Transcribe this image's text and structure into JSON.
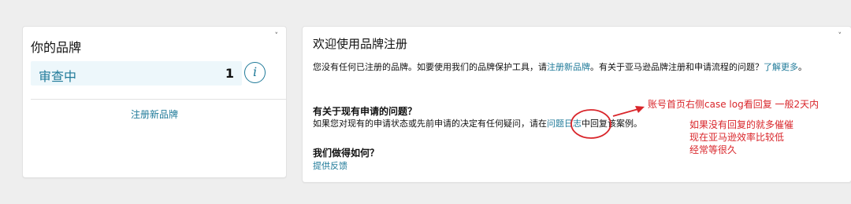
{
  "left_card": {
    "title": "你的品牌",
    "collapse_glyph": "˅",
    "review": {
      "label": "审查中",
      "count": "1",
      "info_glyph": "i"
    },
    "register_link": "注册新品牌"
  },
  "right_card": {
    "title": "欢迎使用品牌注册",
    "collapse_glyph": "˅",
    "intro": {
      "part1": "您没有任何已注册的品牌。如要使用我们的品牌保护工具，请",
      "link1": "注册新品牌",
      "part2": "。有关于亚马逊品牌注册和申请流程的问题？",
      "link2": "了解更多",
      "part3": "。"
    },
    "section1": {
      "heading": "有关于现有申请的问题？",
      "text_before": "如果您对现有的申请状态或先前申请的决定有任何疑问，请在",
      "link": "问题日志",
      "text_after": "中回复该案例。"
    },
    "section2": {
      "heading": "我们做得如何？",
      "link": "提供反馈"
    }
  },
  "annotations": {
    "arrow_note": "账号首页右侧case log看回复 一般2天内",
    "side_note_lines": [
      "如果没有回复的就多催催",
      "现在亚马逊效率比较低",
      "经常等很久"
    ],
    "color": "#d9262b"
  }
}
